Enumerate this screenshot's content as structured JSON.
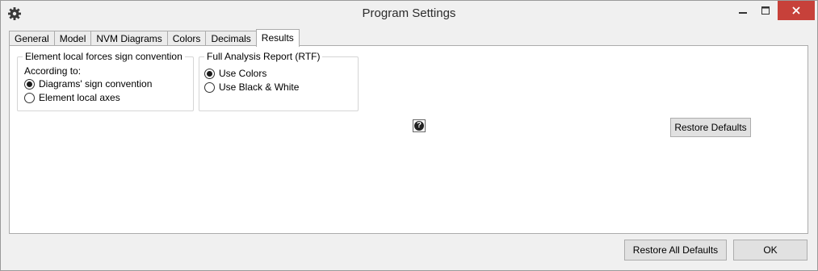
{
  "window": {
    "title": "Program Settings",
    "icons": {
      "app": "gear-icon",
      "minimize": "minimize-icon",
      "maximize": "maximize-icon",
      "close": "close-icon"
    }
  },
  "tabs": [
    {
      "label": "General",
      "active": false
    },
    {
      "label": "Model",
      "active": false
    },
    {
      "label": "NVM Diagrams",
      "active": false
    },
    {
      "label": "Colors",
      "active": false
    },
    {
      "label": "Decimals",
      "active": false
    },
    {
      "label": "Results",
      "active": true
    }
  ],
  "sign_convention": {
    "title": "Element local forces sign convention",
    "subtitle": "According to:",
    "options": [
      {
        "label": "Diagrams' sign convention",
        "selected": true
      },
      {
        "label": "Element local axes",
        "selected": false
      }
    ]
  },
  "report": {
    "title": "Full Analysis Report (RTF)",
    "options": [
      {
        "label": "Use Colors",
        "selected": true
      },
      {
        "label": "Use Black & White",
        "selected": false
      }
    ]
  },
  "help": {
    "icon": "help-icon",
    "glyph": "?"
  },
  "buttons": {
    "restore_defaults": "Restore Defaults",
    "restore_all_defaults": "Restore All Defaults",
    "ok": "OK"
  }
}
